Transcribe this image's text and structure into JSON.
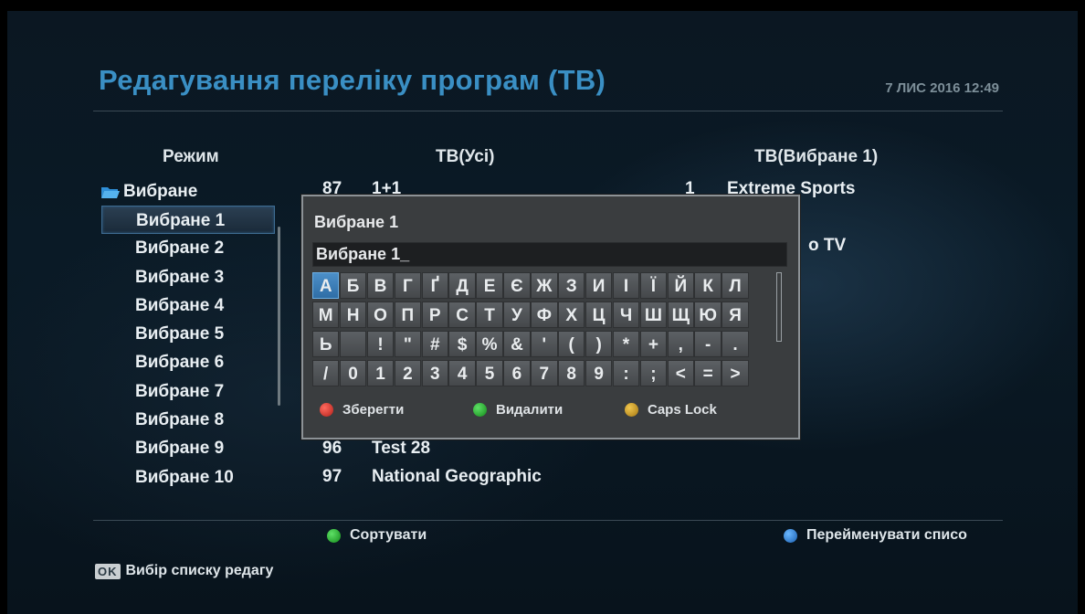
{
  "header": {
    "title": "Редагування переліку програм (ТВ)",
    "datetime": "7 ЛИС 2016 12:49"
  },
  "columns": {
    "mode": "Режим",
    "all": "ТВ(Усі)",
    "favorite": "ТВ(Вибране 1)"
  },
  "mode_list": {
    "folder_label": "Вибране",
    "items": [
      "Вибране 1",
      "Вибране 2",
      "Вибране 3",
      "Вибране 4",
      "Вибране 5",
      "Вибране 6",
      "Вибране 7",
      "Вибране 8",
      "Вибране 9",
      "Вибране 10"
    ],
    "selected_index": 0
  },
  "channels_all": [
    {
      "num": "87",
      "name": "1+1"
    },
    {
      "num": "96",
      "name": "Test 28"
    },
    {
      "num": "97",
      "name": "National Geographic"
    }
  ],
  "channels_favorite": [
    {
      "num": "1",
      "name": "Extreme Sports"
    },
    {
      "num": "",
      "name": "o TV"
    }
  ],
  "rename_dialog": {
    "title": "Вибране 1",
    "input_value": "Вибране 1_",
    "keyboard_rows": [
      [
        "А",
        "Б",
        "В",
        "Г",
        "Ґ",
        "Д",
        "Е",
        "Є",
        "Ж",
        "З",
        "И",
        "І",
        "Ї",
        "Й",
        "К",
        "Л"
      ],
      [
        "М",
        "Н",
        "О",
        "П",
        "Р",
        "С",
        "Т",
        "У",
        "Ф",
        "Х",
        "Ц",
        "Ч",
        "Ш",
        "Щ",
        "Ю",
        "Я"
      ],
      [
        "Ь",
        " ",
        "!",
        "\"",
        "#",
        "$",
        "%",
        "&",
        "'",
        "(",
        ")",
        "*",
        "+",
        ",",
        "-",
        "."
      ],
      [
        "/",
        "0",
        "1",
        "2",
        "3",
        "4",
        "5",
        "6",
        "7",
        "8",
        "9",
        ":",
        ";",
        "<",
        "=",
        ">"
      ]
    ],
    "active_key": "А",
    "legend": [
      {
        "color": "#d0322c",
        "label": "Зберегти"
      },
      {
        "color": "#23a42a",
        "label": "Видалити"
      },
      {
        "color": "#c99a1e",
        "label": "Caps Lock"
      }
    ]
  },
  "bottom": {
    "sort_label": "Сортувати",
    "rename_label": "Перейменувати списо",
    "ok_badge": "OK",
    "ok_hint": "Вибір списку редагу"
  },
  "colors": {
    "title": "#3a8fc4",
    "green": "#23a42a",
    "blue": "#2f7fd0"
  }
}
